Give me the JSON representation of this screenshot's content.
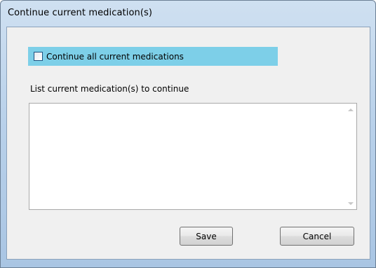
{
  "window": {
    "title": "Continue current medication(s)"
  },
  "form": {
    "continue_all_label": "Continue all current medications",
    "continue_all_checked": false,
    "list_label": "List current medication(s) to continue",
    "list_value": ""
  },
  "buttons": {
    "save": "Save",
    "cancel": "Cancel"
  },
  "colors": {
    "checkbox_row_highlight": "#7dcfe8",
    "window_frame": "#b9d1ea",
    "client_background": "#f0f0f0"
  }
}
